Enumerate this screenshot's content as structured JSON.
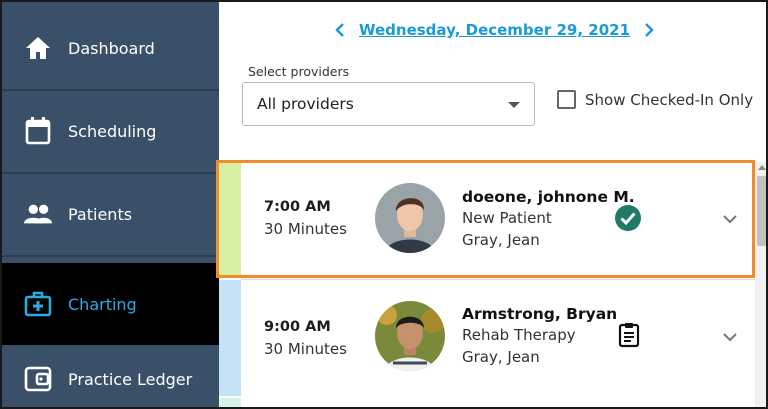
{
  "sidebar": {
    "items": [
      {
        "label": "Dashboard",
        "icon": "home-icon",
        "active": false
      },
      {
        "label": "Scheduling",
        "icon": "calendar-icon",
        "active": false
      },
      {
        "label": "Patients",
        "icon": "people-icon",
        "active": false
      },
      {
        "label": "Charting",
        "icon": "medical-kit-icon",
        "active": true
      },
      {
        "label": "Practice Ledger",
        "icon": "wallet-icon",
        "active": false
      }
    ]
  },
  "header": {
    "date": "Wednesday, December 29, 2021",
    "prev_icon": "chevron-left-icon",
    "next_icon": "chevron-right-icon"
  },
  "filters": {
    "providers_label": "Select providers",
    "providers_value": "All providers",
    "checked_in_label": "Show Checked-In Only",
    "checked_in": false
  },
  "appointments": [
    {
      "time": "7:00 AM",
      "duration": "30 Minutes",
      "patient": "doeone, johnone M.",
      "type": "New Patient",
      "provider": "Gray, Jean",
      "status_icon": "checked-in-icon",
      "stripe_color": "#d4f0a0"
    },
    {
      "time": "9:00 AM",
      "duration": "30 Minutes",
      "patient": "Armstrong, Bryan",
      "type": "Rehab Therapy",
      "provider": "Gray, Jean",
      "status_icon": "clipboard-icon",
      "stripe_color": "#c5e3f7"
    }
  ],
  "colors": {
    "sidebar_bg": "#3a5069",
    "active_bg": "#000000",
    "active_text": "#29abe2",
    "accent_link": "#1a9ad6",
    "check_green": "#1e7a66",
    "highlight": "#f28c28"
  }
}
